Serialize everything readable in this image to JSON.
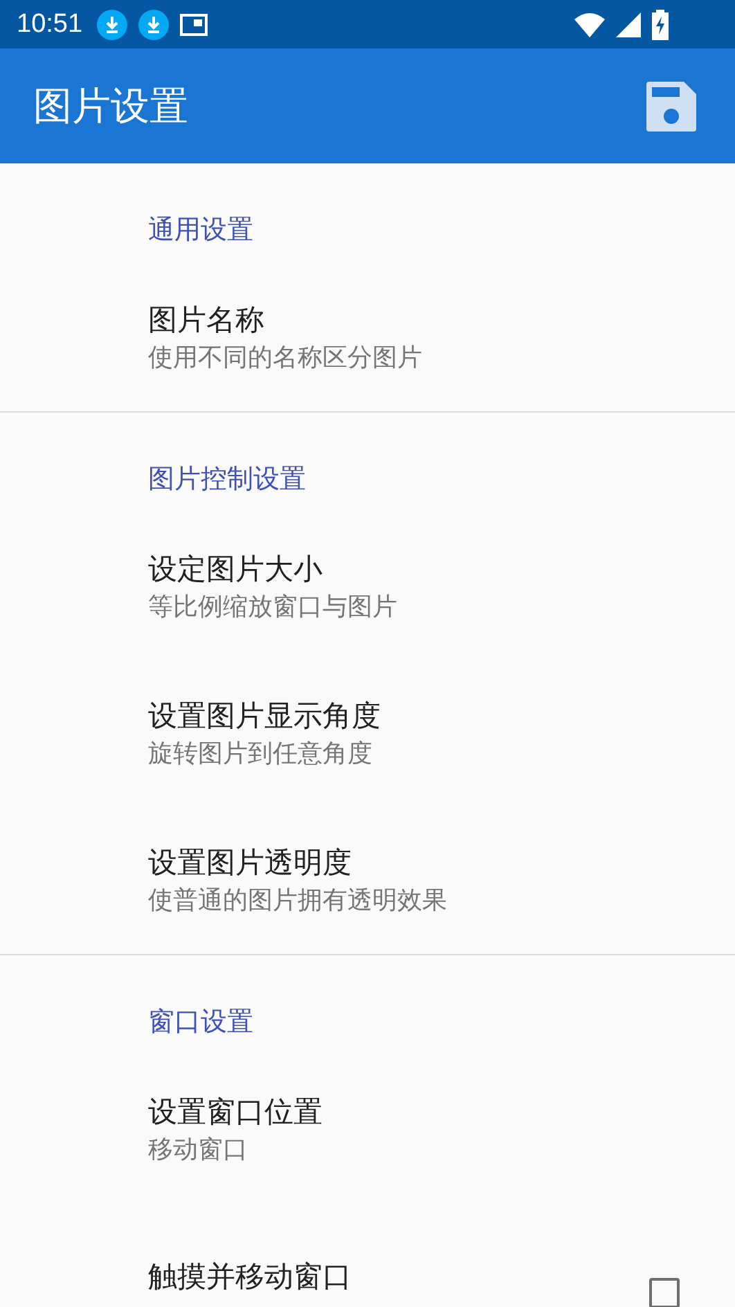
{
  "status_bar": {
    "time": "10:51"
  },
  "app_bar": {
    "title": "图片设置"
  },
  "sections": [
    {
      "header": "通用设置",
      "items": [
        {
          "kind": "text",
          "title": "图片名称",
          "summary": "使用不同的名称区分图片"
        }
      ]
    },
    {
      "header": "图片控制设置",
      "items": [
        {
          "kind": "text",
          "title": "设定图片大小",
          "summary": "等比例缩放窗口与图片"
        },
        {
          "kind": "text",
          "title": "设置图片显示角度",
          "summary": "旋转图片到任意角度"
        },
        {
          "kind": "text",
          "title": "设置图片透明度",
          "summary": "使普通的图片拥有透明效果"
        }
      ]
    },
    {
      "header": "窗口设置",
      "items": [
        {
          "kind": "text",
          "title": "设置窗口位置",
          "summary": "移动窗口"
        },
        {
          "kind": "checkbox",
          "title": "触摸并移动窗口",
          "checked": false
        }
      ]
    }
  ]
}
